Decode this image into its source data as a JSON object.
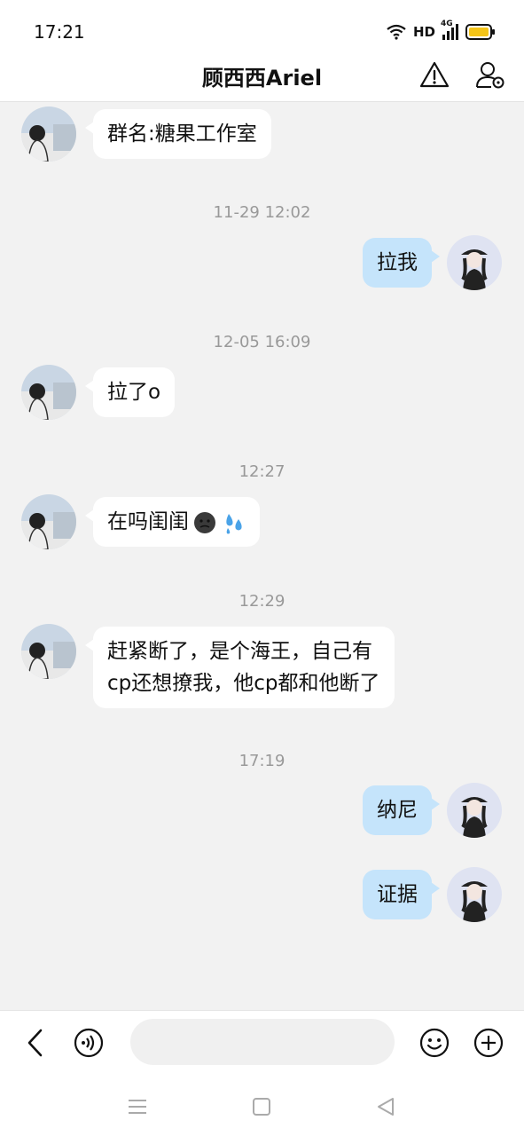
{
  "status_bar": {
    "time": "17:21",
    "network": "HD",
    "signal": "4G"
  },
  "header": {
    "title": "顾西西Ariel"
  },
  "messages": [
    {
      "dir": "in",
      "text": "群名:糖果工作室"
    },
    {
      "timestamp": "11-29 12:02"
    },
    {
      "dir": "out",
      "text": "拉我"
    },
    {
      "timestamp": "12-05 16:09"
    },
    {
      "dir": "in",
      "text": "拉了o"
    },
    {
      "timestamp": "12:27"
    },
    {
      "dir": "in",
      "text": "在吗闺闺",
      "emoji": [
        "dark-face",
        "sweat-droplets"
      ]
    },
    {
      "timestamp": "12:29"
    },
    {
      "dir": "in",
      "lines": [
        "赶紧断了，是个海王，自己有",
        "cp还想撩我，他cp都和他断了"
      ]
    },
    {
      "timestamp": "17:19"
    },
    {
      "dir": "out",
      "text": "纳尼"
    },
    {
      "dir": "out",
      "text": "证据"
    }
  ],
  "input": {
    "placeholder": ""
  },
  "icons": {
    "header": [
      "warning-icon",
      "contact-settings-icon"
    ],
    "input_bar": [
      "back-chevron-icon",
      "voice-icon",
      "emoji-icon",
      "plus-icon"
    ],
    "nav": [
      "menu-icon",
      "home-icon",
      "back-icon"
    ]
  },
  "colors": {
    "outgoing_bubble": "#c5e4fb",
    "incoming_bubble": "#ffffff",
    "background": "#f2f2f2",
    "battery": "#f5c518"
  }
}
